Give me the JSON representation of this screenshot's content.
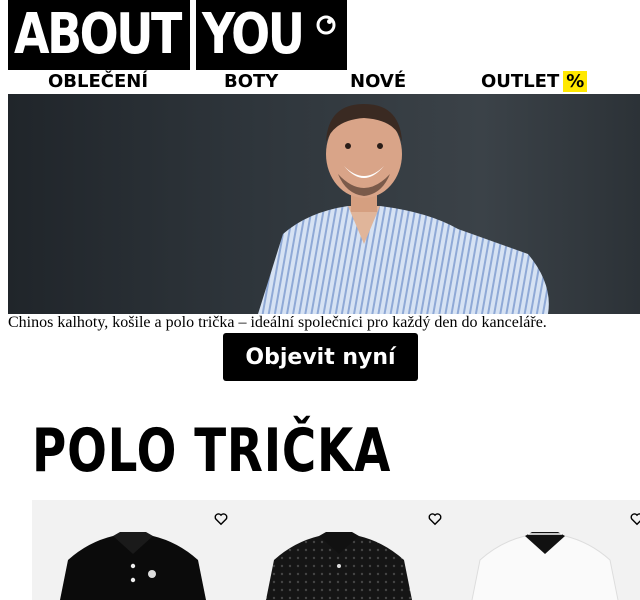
{
  "brand": {
    "part1": "ABOUT",
    "part2": "YOU"
  },
  "nav": {
    "items": [
      {
        "label": "OBLEČENÍ"
      },
      {
        "label": "BOTY"
      },
      {
        "label": "NOVÉ"
      },
      {
        "label": "OUTLET",
        "badge": "%"
      }
    ]
  },
  "hero": {
    "caption": "Chinos kalhoty, košile a polo trička – ideální společníci pro každý den do kanceláře.",
    "cta": "Objevit nyní"
  },
  "section": {
    "title": "POLO TRIČKA"
  },
  "colors": {
    "accent_yellow": "#ffe800",
    "black": "#000000",
    "card_bg": "#f2f2f2"
  },
  "products": [
    {
      "icon": "heart-icon",
      "color": "black"
    },
    {
      "icon": "heart-icon",
      "color": "black-pattern"
    },
    {
      "icon": "heart-icon",
      "color": "white"
    }
  ]
}
